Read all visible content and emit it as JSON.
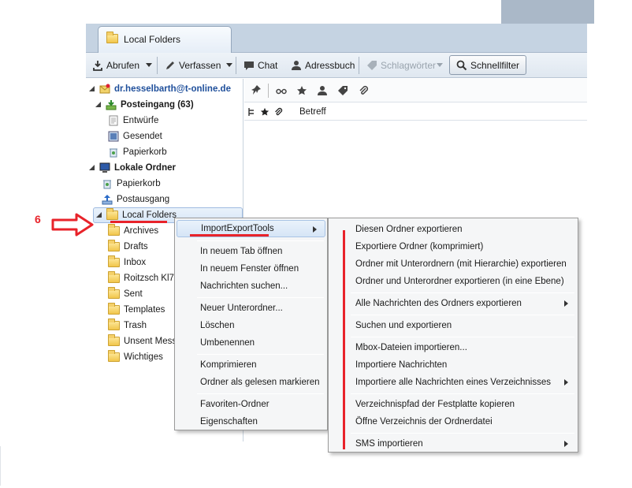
{
  "tab": {
    "title": "Local Folders"
  },
  "toolbar": {
    "abrufen": "Abrufen",
    "verfassen": "Verfassen",
    "chat": "Chat",
    "adressbuch": "Adressbuch",
    "schlagwoerter": "Schlagwörter",
    "schnellfilter": "Schnellfilter"
  },
  "folders": {
    "account": "dr.hesselbarth@t-online.de",
    "posteingang": "Posteingang (63)",
    "entwuerfe": "Entwürfe",
    "gesendet": "Gesendet",
    "papierkorb1": "Papierkorb",
    "lokale": "Lokale Ordner",
    "papierkorb2": "Papierkorb",
    "postausgang": "Postausgang",
    "local_folders": "Local Folders",
    "archives": "Archives",
    "drafts": "Drafts",
    "inbox": "Inbox",
    "roitzsch": "Roitzsch Kl7d",
    "sent": "Sent",
    "templates": "Templates",
    "trash": "Trash",
    "unsent": "Unsent Messa",
    "wichtiges": "Wichtiges"
  },
  "messages": {
    "betreff": "Betreff"
  },
  "annotation": {
    "step": "6"
  },
  "menu1": {
    "importexport": "ImportExportTools",
    "neuer_tab": "In neuem Tab öffnen",
    "neues_fenster": "In neuem Fenster öffnen",
    "nachrichten_suchen": "Nachrichten suchen...",
    "neuer_unterordner": "Neuer Unterordner...",
    "loeschen": "Löschen",
    "umbenennen": "Umbenennen",
    "komprimieren": "Komprimieren",
    "gelesen": "Ordner als gelesen markieren",
    "favoriten": "Favoriten-Ordner",
    "eigenschaften": "Eigenschaften"
  },
  "menu2": {
    "i1": "Diesen Ordner exportieren",
    "i2": "Exportiere Ordner (komprimiert)",
    "i3": "Ordner mit Unterordnern (mit Hierarchie) exportieren",
    "i4": "Ordner und Unterordner exportieren (in eine Ebene)",
    "i5": "Alle Nachrichten des Ordners exportieren",
    "i6": "Suchen und exportieren",
    "i7": "Mbox-Dateien importieren...",
    "i8": "Importiere Nachrichten",
    "i9": "Importiere alle Nachrichten eines Verzeichnisses",
    "i10": "Verzeichnispfad der Festplatte kopieren",
    "i11": "Öffne Verzeichnis der Ordnerdatei",
    "i12": "SMS importieren"
  }
}
